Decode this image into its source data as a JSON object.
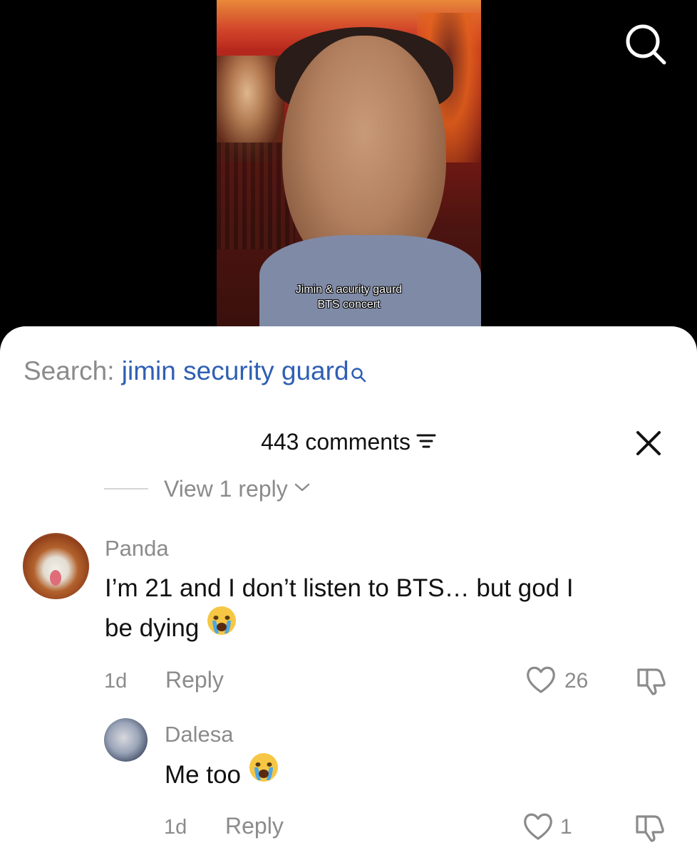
{
  "video": {
    "caption_line1": "Jimin & acurity gaurd",
    "caption_line2": "BTS concert"
  },
  "icons": {
    "search": "search-icon",
    "filter": "filter-icon",
    "close": "close-icon",
    "chevron": "chevron-down-icon",
    "like": "heart-icon",
    "dislike": "thumbs-down-icon",
    "emoji": "crying-face-emoji"
  },
  "sheet": {
    "search_prefix": "Search: ",
    "search_term": "jimin security guard",
    "comments_count_label": "443 comments",
    "view_replies_label": "View 1 reply"
  },
  "comments": [
    {
      "username": "Panda",
      "text_line1": "I’m 21 and I don’t listen to BTS… but god I",
      "text_line2": "be dying",
      "time": "1d",
      "reply_label": "Reply",
      "likes": "26"
    },
    {
      "username": "Dalesa",
      "text": "Me too",
      "time": "1d",
      "reply_label": "Reply",
      "likes": "1"
    }
  ],
  "colors": {
    "search_term": "#2f5fb3",
    "secondary_text": "#8b8b8b",
    "primary_text": "#111111"
  }
}
